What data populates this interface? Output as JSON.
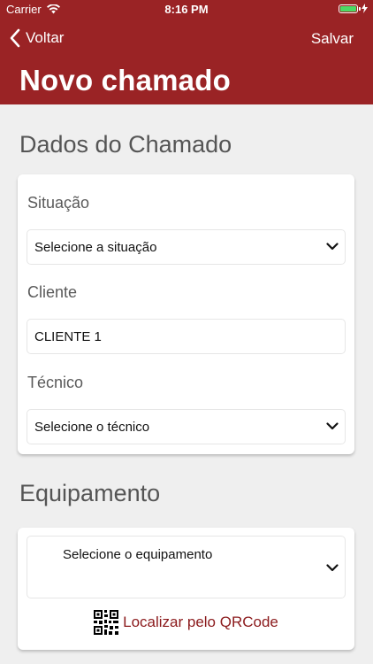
{
  "status_bar": {
    "carrier": "Carrier",
    "time": "8:16 PM",
    "icons": [
      "wifi-icon",
      "battery-icon",
      "charging-icon"
    ]
  },
  "nav": {
    "back_label": "Voltar",
    "save_label": "Salvar",
    "title": "Novo chamado",
    "bar_color": "#9a2325"
  },
  "sections": {
    "dados": {
      "title": "Dados do Chamado",
      "situacao_label": "Situação",
      "situacao_value": "Selecione a situação",
      "cliente_label": "Cliente",
      "cliente_value": "CLIENTE 1",
      "tecnico_label": "Técnico",
      "tecnico_value": "Selecione o técnico"
    },
    "equipamento": {
      "title": "Equipamento",
      "select_value": "Selecione o equipamento",
      "qr_label": "Localizar pelo QRCode",
      "link_color": "#8b1a1c"
    }
  }
}
